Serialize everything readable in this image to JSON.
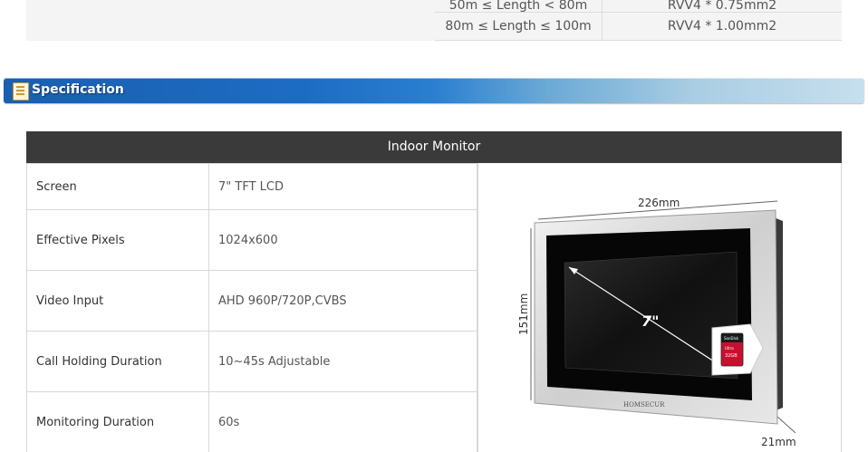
{
  "cable_table": {
    "rows": [
      {
        "length": "50m ≤ Length < 80m",
        "cable": "RVV4 * 0.75mm2"
      },
      {
        "length": "80m ≤ Length ≤ 100m",
        "cable": "RVV4 * 1.00mm2"
      }
    ]
  },
  "section": {
    "title": "Specification"
  },
  "indoor_monitor": {
    "header": "Indoor Monitor",
    "rows": [
      {
        "label": "Screen",
        "value": "7\" TFT LCD"
      },
      {
        "label": "Effective Pixels",
        "value": "1024x600"
      },
      {
        "label": "Video Input",
        "value": "AHD 960P/720P,CVBS"
      },
      {
        "label": "Call Holding Duration",
        "value": "10~45s Adjustable"
      },
      {
        "label": "Monitoring Duration",
        "value": "60s"
      }
    ],
    "image": {
      "width_label": "226mm",
      "height_label": "151mm",
      "depth_label": "21mm",
      "screen_size_label": "7\"",
      "brand": "HOMSECUR",
      "sd_card": {
        "brand": "SanDisk",
        "type": "Ultra",
        "capacity": "32GB"
      }
    }
  },
  "colors": {
    "header_bg": "#3a3a3a",
    "banner_start": "#1a5fb0",
    "banner_end": "#c7dfee"
  }
}
